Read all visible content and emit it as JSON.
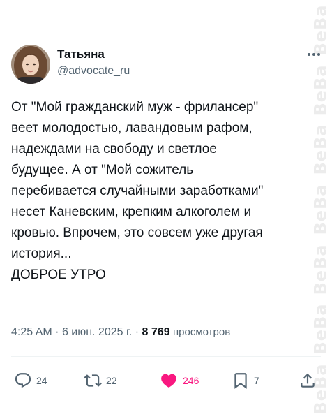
{
  "tweet": {
    "author": {
      "display_name": "Татьяна",
      "handle": "@advocate_ru"
    },
    "text_lines": [
      "От \"Мой гражданский муж -  фрилансер\"",
      "веет молодостью, лавандовым рафом,",
      "надеждами на свободу и светлое",
      "будущее. А от \"Мой сожитель",
      "перебивается случайными заработками\"",
      "несет Каневским, крепким алкоголем и",
      "кровью. Впрочем, это совсем уже другая",
      "история...",
      "ДОБРОЕ УТРО"
    ],
    "time": "4:25 AM",
    "date": "6 июн. 2025 г.",
    "separator": "·",
    "views_count": "8 769",
    "views_label": "просмотров"
  },
  "actions": {
    "replies": "24",
    "reposts": "22",
    "likes": "246",
    "bookmarks": "7"
  },
  "icons": {
    "more": "more-icon",
    "reply": "reply-icon",
    "repost": "repost-icon",
    "like": "heart-icon",
    "bookmark": "bookmark-icon",
    "share": "share-icon"
  },
  "watermark": "BeBa",
  "colors": {
    "text": "#0f1419",
    "secondary": "#536471",
    "like": "#f91880",
    "divider": "#eff3f4"
  }
}
